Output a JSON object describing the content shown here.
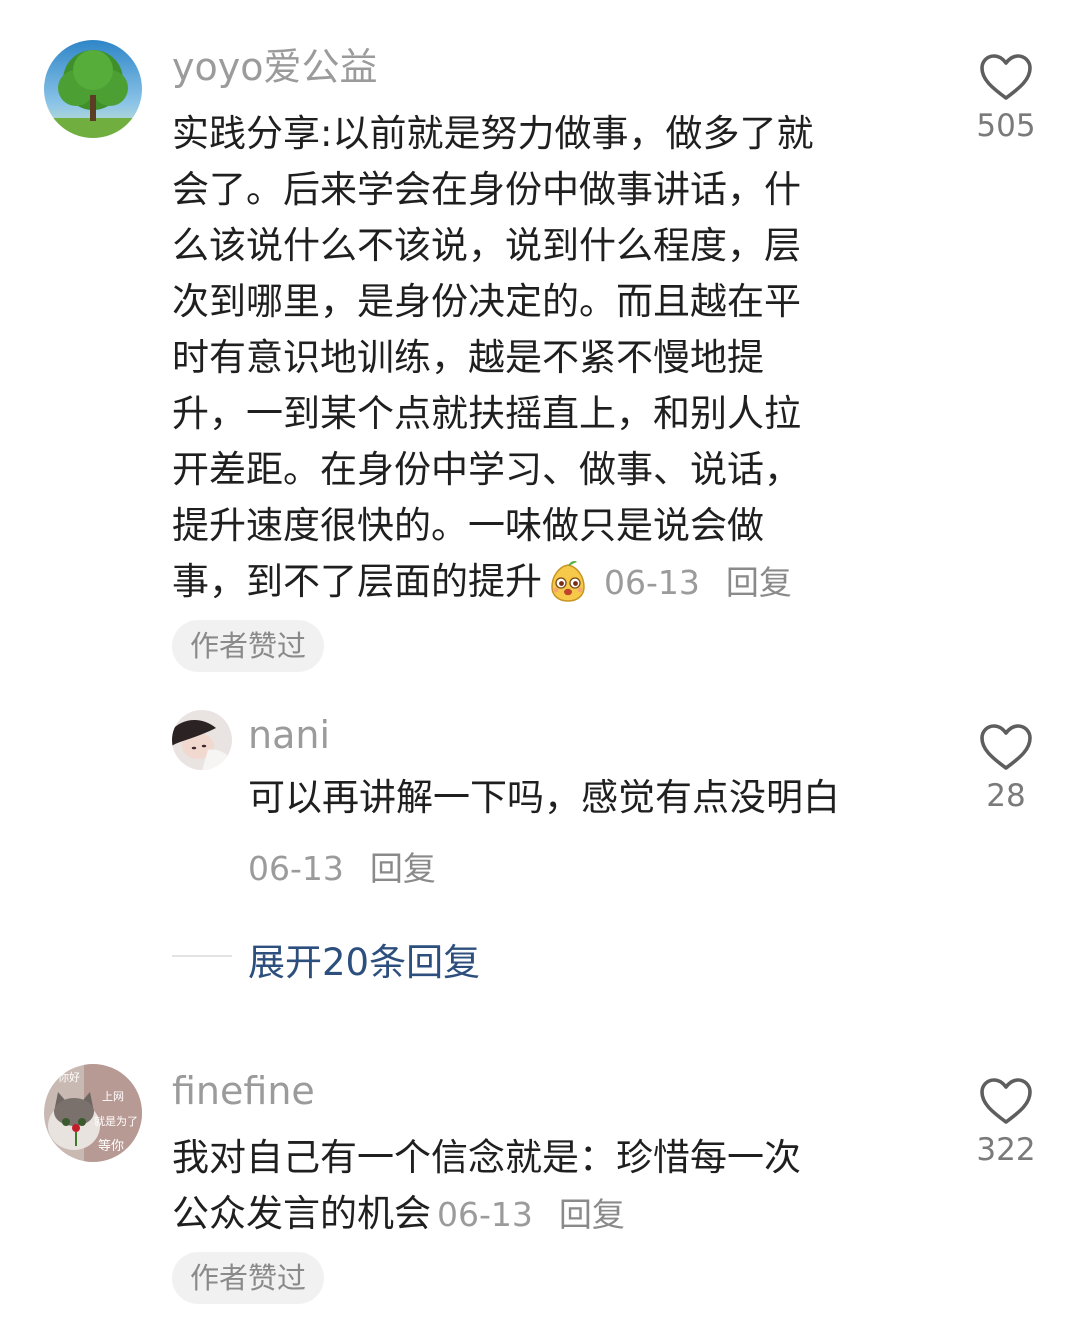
{
  "comments": [
    {
      "username": "yoyo爱公益",
      "avatar": "tree-photo",
      "lines": [
        "实践分享:以前就是努力做事，做多了就",
        "会了。后来学会在身份中做事讲话，什",
        "么该说什么不该说，说到什么程度，层",
        "次到哪里，是身份决定的。而且越在平",
        "时有意识地训练，越是不紧不慢地提",
        "升，一到某个点就扶摇直上，和别人拉",
        "开差距。在身份中学习、做事、说话，",
        "提升速度很快的。一味做只是说会做",
        "事，到不了层面的提升"
      ],
      "emoji": "pear-face-emoji",
      "date": "06-13",
      "reply_label": "回复",
      "badge": "作者赞过",
      "likes": "505"
    },
    {
      "username": "nani",
      "avatar": "person-photo",
      "text": "可以再讲解一下吗，感觉有点没明白",
      "date": "06-13",
      "reply_label": "回复",
      "likes": "28",
      "expand_label": "展开20条回复"
    },
    {
      "username": "finefine",
      "avatar": "cat-with-rose-photo",
      "avatar_text": [
        "你好",
        "上网",
        "就是为了",
        "等你"
      ],
      "lines": [
        "我对自己有一个信念就是：珍惜每一次",
        "公众发言的机会"
      ],
      "date": "06-13",
      "reply_label": "回复",
      "badge": "作者赞过",
      "likes": "322"
    }
  ],
  "colors": {
    "meta_gray": "#9b9b9b",
    "text": "#1f1f1f",
    "expand_blue": "#2d4f7e",
    "badge_bg": "#f1f1f1"
  }
}
